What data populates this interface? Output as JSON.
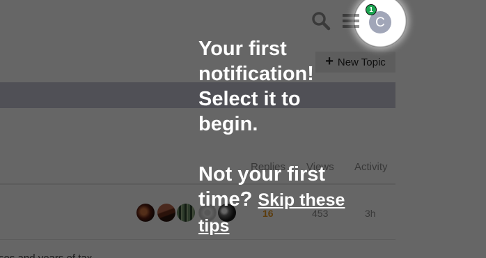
{
  "header": {
    "search_icon": "search-icon",
    "menu_icon": "hamburger-menu-icon",
    "avatar_initial": "C",
    "notification_count": "1",
    "colors": {
      "avatar": "#a1a6b8",
      "badge": "#1ca551"
    }
  },
  "toolbar": {
    "new_topic_label": "New Topic",
    "new_topic_icon": "plus-icon"
  },
  "topic_list": {
    "columns": [
      "Replies",
      "Views",
      "Activity"
    ],
    "rows": [
      {
        "replies": "16",
        "views": "453",
        "activity": "3h",
        "excerpt": "ses and years of tax"
      }
    ]
  },
  "tip": {
    "line1": "Your first notification! Select it to begin.",
    "line2": "Not your first time?",
    "skip_label": "Skip these tips"
  },
  "colors": {
    "overlay": "rgba(0,0,0,0.6)",
    "category_bar": "#c8c8d6",
    "replies_highlight": "#e5951f"
  }
}
